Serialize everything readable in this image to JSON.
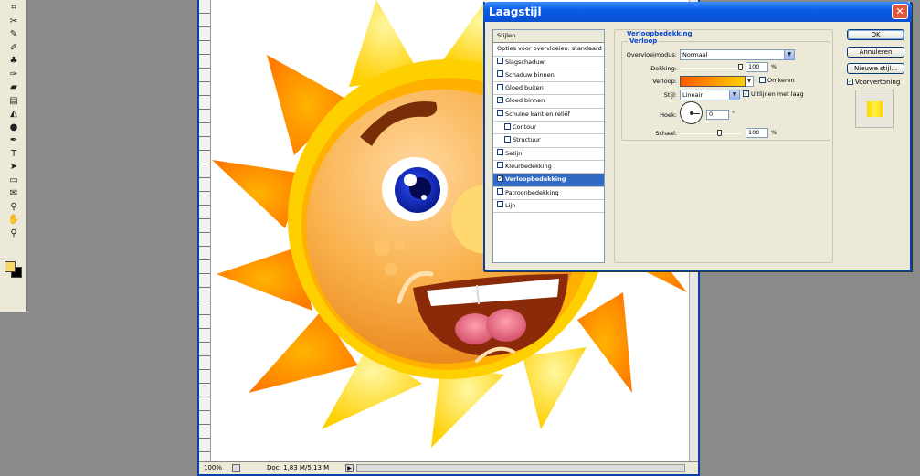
{
  "toolbox": {
    "tools": [
      {
        "icon": "crop-icon",
        "glyph": "⌗"
      },
      {
        "icon": "slice-icon",
        "glyph": "✂"
      },
      {
        "icon": "healing-brush-icon",
        "glyph": "✎"
      },
      {
        "icon": "brush-icon",
        "glyph": "✐"
      },
      {
        "icon": "clone-stamp-icon",
        "glyph": "♣"
      },
      {
        "icon": "history-brush-icon",
        "glyph": "✑"
      },
      {
        "icon": "eraser-icon",
        "glyph": "▰"
      },
      {
        "icon": "gradient-icon",
        "glyph": "▤"
      },
      {
        "icon": "blur-icon",
        "glyph": "◭"
      },
      {
        "icon": "dodge-icon",
        "glyph": "●"
      },
      {
        "icon": "pen-icon",
        "glyph": "✒"
      },
      {
        "icon": "type-icon",
        "glyph": "T"
      },
      {
        "icon": "path-selection-icon",
        "glyph": "➤"
      },
      {
        "icon": "shape-icon",
        "glyph": "▭"
      },
      {
        "icon": "notes-icon",
        "glyph": "✉"
      },
      {
        "icon": "eyedropper-icon",
        "glyph": "⚲"
      },
      {
        "icon": "hand-icon",
        "glyph": "✋"
      },
      {
        "icon": "zoom-icon",
        "glyph": "⚲"
      }
    ],
    "foreground_color": "#f7d66b",
    "background_color": "#000000"
  },
  "document": {
    "zoom": "100%",
    "doc_info": "Doc: 1,83 M/5,13 M"
  },
  "dialog": {
    "title": "Laagstijl",
    "close_glyph": "✕",
    "styles_header": "Stijlen",
    "blending_options": "Opties voor overvloeien: standaard",
    "effects": [
      {
        "label": "Slagschaduw",
        "checked": false,
        "indent": false,
        "selected": false
      },
      {
        "label": "Schaduw binnen",
        "checked": false,
        "indent": false,
        "selected": false
      },
      {
        "label": "Gloed buiten",
        "checked": false,
        "indent": false,
        "selected": false
      },
      {
        "label": "Gloed binnen",
        "checked": true,
        "indent": false,
        "selected": false
      },
      {
        "label": "Schuine kant en reliëf",
        "checked": false,
        "indent": false,
        "selected": false
      },
      {
        "label": "Contour",
        "checked": false,
        "indent": true,
        "selected": false
      },
      {
        "label": "Structuur",
        "checked": false,
        "indent": true,
        "selected": false
      },
      {
        "label": "Satijn",
        "checked": false,
        "indent": false,
        "selected": false
      },
      {
        "label": "Kleurbedekking",
        "checked": false,
        "indent": false,
        "selected": false
      },
      {
        "label": "Verloopbedekking",
        "checked": true,
        "indent": false,
        "selected": true
      },
      {
        "label": "Patroonbedekking",
        "checked": false,
        "indent": false,
        "selected": false
      },
      {
        "label": "Lijn",
        "checked": false,
        "indent": false,
        "selected": false
      }
    ],
    "panel_title": "Verloopbedekking",
    "group_title": "Verloop",
    "blend_mode_label": "Overvloeimodus:",
    "blend_mode_value": "Normaal",
    "opacity_label": "Dekking:",
    "opacity_value": "100",
    "opacity_level": 1.0,
    "gradient_label": "Verloop:",
    "reverse_label": "Omkeren",
    "reverse_checked": false,
    "style_label": "Stijl:",
    "style_value": "Lineair",
    "align_label": "Uitlijnen met laag",
    "align_checked": true,
    "angle_label": "Hoek:",
    "angle_value": "0",
    "angle_unit": "°",
    "scale_label": "Schaal:",
    "scale_value": "100",
    "scale_level": 0.66,
    "percent": "%",
    "buttons": {
      "ok": "OK",
      "cancel": "Annuleren",
      "new_style": "Nieuwe stijl..."
    },
    "preview_label": "Voorvertoning",
    "preview_checked": true,
    "check_glyph": "✓"
  },
  "colors": {
    "title_blue": "#0a4fd0",
    "selection_blue": "#316ac5",
    "gradient_start": "#ff5a00",
    "gradient_end": "#ffd000"
  }
}
